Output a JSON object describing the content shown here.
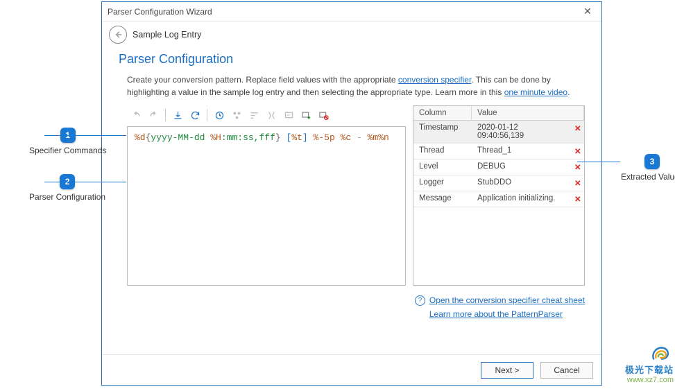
{
  "dialog": {
    "title": "Parser Configuration Wizard",
    "close_label": "✕",
    "breadcrumb": "Sample Log Entry"
  },
  "section": {
    "heading": "Parser Configuration",
    "desc_pre": "Create your conversion pattern.  Replace field values with the appropriate ",
    "desc_link1": "conversion specifier",
    "desc_mid": ".  This can be done by highlighting a value in the sample log entry and then selecting the appropriate type.  Learn more in this ",
    "desc_link2": "one minute video",
    "desc_post": "."
  },
  "editor": {
    "tokens": {
      "d": "%d",
      "brace_o": "{",
      "fmt": "yyyy-MM-dd ",
      "H": "%H",
      "rest": ":mm:ss,fff",
      "brace_c": "}",
      "sp1": " ",
      "br_o": "[",
      "t": "%t",
      "br_c": "]",
      "sp2": " ",
      "p": "%-5p",
      "sp3": " ",
      "c": "%c",
      "sp4": " - ",
      "m": "%m",
      "n": "%n"
    }
  },
  "table": {
    "head_col1": "Column",
    "head_col2": "Value",
    "rows": [
      {
        "col": "Timestamp",
        "val": "2020-01-12\n09:40:56,139"
      },
      {
        "col": "Thread",
        "val": "Thread_1"
      },
      {
        "col": "Level",
        "val": "DEBUG"
      },
      {
        "col": "Logger",
        "val": "StubDDO"
      },
      {
        "col": "Message",
        "val": "Application initializing."
      }
    ],
    "remove_glyph": "✕"
  },
  "links": {
    "q": "?",
    "cheat": "Open the conversion specifier cheat sheet",
    "learn": "Learn more about the PatternParser"
  },
  "buttons": {
    "next": "Next >",
    "cancel": "Cancel"
  },
  "callouts": {
    "c1_num": "1",
    "c1_label": "Specifier Commands",
    "c2_num": "2",
    "c2_label": "Parser Configuration",
    "c3_num": "3",
    "c3_label": "Extracted Values"
  },
  "watermark": {
    "cn": "极光下载站",
    "url": "www.xz7.com"
  }
}
